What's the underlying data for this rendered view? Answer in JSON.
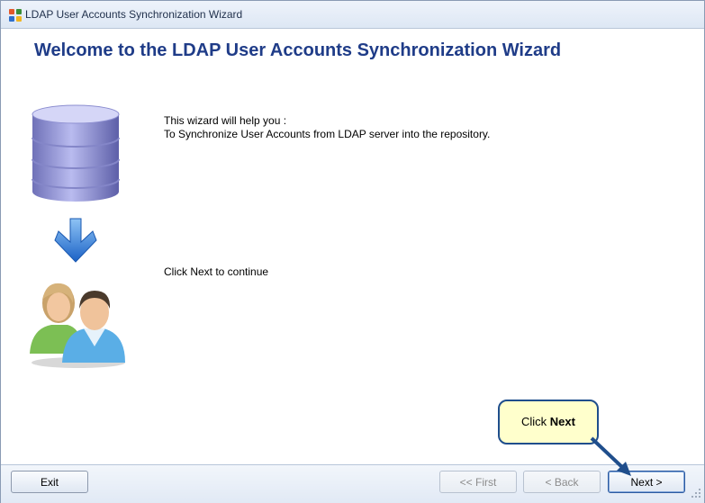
{
  "window": {
    "title": "LDAP User Accounts Synchronization Wizard"
  },
  "main": {
    "heading": "Welcome to the LDAP User Accounts Synchronization Wizard",
    "intro_line1": "This wizard will help you :",
    "intro_line2": "To Synchronize User Accounts from LDAP server into the repository.",
    "continue_text": "Click Next to continue"
  },
  "buttons": {
    "exit": "Exit",
    "first": "<< First",
    "back": "< Back",
    "next": "Next >"
  },
  "callout": {
    "prefix": "Click",
    "emphasis": "Next"
  },
  "colors": {
    "heading": "#1f3c88",
    "callout_fill": "#ffffcc",
    "callout_border": "#1f4e8c"
  },
  "icons": {
    "database": "database-icon",
    "arrow": "arrow-down-icon",
    "users": "users-icon"
  }
}
